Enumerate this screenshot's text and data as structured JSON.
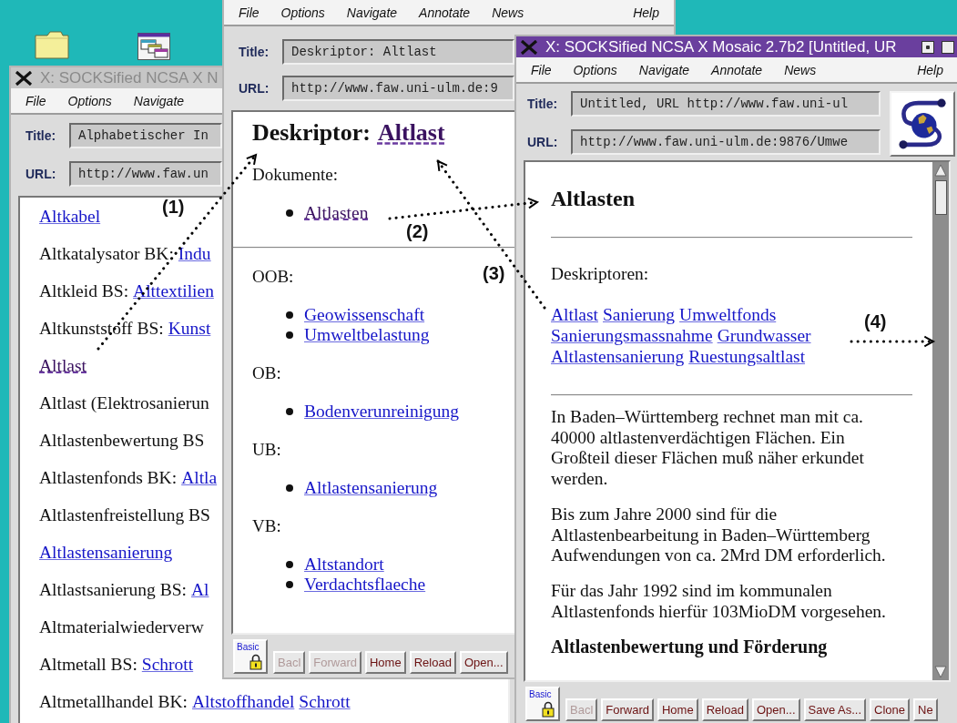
{
  "index_window": {
    "title_bar": {
      "title": "X: SOCKSified NCSA X N",
      "active": false
    },
    "menu": [
      {
        "label": "File"
      },
      {
        "label": "Options"
      },
      {
        "label": "Navigate"
      }
    ],
    "title_field": {
      "label": "Title:",
      "value": "Alphabetischer In"
    },
    "url_field": {
      "label": "URL:",
      "value": "http://www.faw.un"
    },
    "rows": [
      {
        "links": [
          {
            "text": "Altkabel",
            "visited": false
          }
        ]
      },
      {
        "term": "Altkatalysator BK:",
        "links": [
          {
            "text": "Indu",
            "visited": false
          }
        ]
      },
      {
        "term": "Altkleid BS:",
        "links": [
          {
            "text": "Alttextilien",
            "visited": false
          }
        ]
      },
      {
        "term": "Altkunststoff BS:",
        "links": [
          {
            "text": "Kunst",
            "visited": false
          }
        ]
      },
      {
        "links": [
          {
            "text": "Altlast",
            "visited": true
          }
        ]
      },
      {
        "term": "Altlast (Elektrosanierun"
      },
      {
        "term": "Altlastenbewertung BS"
      },
      {
        "term": "Altlastenfonds BK:",
        "links": [
          {
            "text": "Altla",
            "visited": false
          }
        ]
      },
      {
        "term": "Altlastenfreistellung BS"
      },
      {
        "links": [
          {
            "text": "Altlastensanierung",
            "visited": false
          }
        ]
      },
      {
        "term": "Altlastsanierung BS:",
        "links": [
          {
            "text": "Al",
            "visited": false
          }
        ]
      },
      {
        "term": "Altmaterialwiederverw"
      },
      {
        "term": "Altmetall BS:",
        "links": [
          {
            "text": "Schrott",
            "visited": false
          }
        ]
      },
      {
        "term": "Altmetallhandel BK:",
        "links": [
          {
            "text": "Altstoffhandel",
            "visited": false
          },
          {
            "text": "Schrott",
            "visited": false
          }
        ]
      }
    ]
  },
  "descriptor_window": {
    "menu": [
      {
        "label": "File",
        "kind": "menu"
      },
      {
        "label": "Options",
        "kind": "menu"
      },
      {
        "label": "Navigate",
        "kind": "menu"
      },
      {
        "label": "Annotate",
        "kind": "menu"
      },
      {
        "label": "News",
        "kind": "menu"
      },
      {
        "label": "Help",
        "kind": "help"
      }
    ],
    "title_field": {
      "label": "Title:",
      "value": "Deskriptor: Altlast"
    },
    "url_field": {
      "label": "URL:",
      "value": "http://www.faw.uni-ulm.de:9"
    },
    "heading": {
      "text": "Deskriptor:",
      "link": {
        "text": "Altlast",
        "visited": true
      }
    },
    "blocks": [
      {
        "kind": "label",
        "text": "Dokumente:"
      },
      {
        "kind": "list",
        "items": [
          {
            "text": "Altlasten",
            "visited": true
          }
        ]
      },
      {
        "kind": "rule"
      },
      {
        "kind": "label",
        "text": "OOB:"
      },
      {
        "kind": "list",
        "items": [
          {
            "text": "Geowissenschaft",
            "visited": false
          },
          {
            "text": "Umweltbelastung",
            "visited": false
          }
        ]
      },
      {
        "kind": "label",
        "text": "OB:"
      },
      {
        "kind": "list",
        "items": [
          {
            "text": "Bodenverunreinigung",
            "visited": false
          }
        ]
      },
      {
        "kind": "label",
        "text": "UB:"
      },
      {
        "kind": "list",
        "items": [
          {
            "text": "Altlastensanierung",
            "visited": false
          }
        ]
      },
      {
        "kind": "label",
        "text": "VB:"
      },
      {
        "kind": "list",
        "items": [
          {
            "text": "Altstandort",
            "visited": false
          },
          {
            "text": "Verdachtsflaeche",
            "visited": false
          }
        ]
      }
    ],
    "security": "Basic",
    "toolbar": [
      {
        "label": "Bacl",
        "disabled": true
      },
      {
        "label": "Forward",
        "disabled": true
      },
      {
        "label": "Home",
        "disabled": false
      },
      {
        "label": "Reload",
        "disabled": false
      },
      {
        "label": "Open...",
        "disabled": false
      }
    ]
  },
  "document_window": {
    "title_bar": {
      "title": "X: SOCKSified NCSA X Mosaic 2.7b2 [Untitled, UR",
      "active": true
    },
    "menu": [
      {
        "label": "File",
        "kind": "menu"
      },
      {
        "label": "Options",
        "kind": "menu"
      },
      {
        "label": "Navigate",
        "kind": "menu"
      },
      {
        "label": "Annotate",
        "kind": "menu"
      },
      {
        "label": "News",
        "kind": "menu"
      },
      {
        "label": "Help",
        "kind": "help"
      }
    ],
    "title_field": {
      "label": "Title:",
      "value": "Untitled, URL http://www.faw.uni-ul"
    },
    "url_field": {
      "label": "URL:",
      "value": "http://www.faw.uni-ulm.de:9876/Umwe"
    },
    "blocks": [
      {
        "kind": "heading",
        "text": "Altlasten"
      },
      {
        "kind": "rule"
      },
      {
        "kind": "label",
        "text": "Deskriptoren:"
      },
      {
        "kind": "links",
        "lines": [
          [
            {
              "text": "Altlast",
              "visited": false
            },
            {
              "text": "Sanierung",
              "visited": false
            },
            {
              "text": "Umweltfonds",
              "visited": false
            }
          ],
          [
            {
              "text": "Sanierungsmassnahme",
              "visited": false
            },
            {
              "text": "Grundwasser",
              "visited": false
            }
          ],
          [
            {
              "text": "Altlastensanierung",
              "visited": false
            },
            {
              "text": "Ruestungsaltlast",
              "visited": false
            }
          ]
        ]
      },
      {
        "kind": "rule"
      },
      {
        "kind": "paragraph",
        "text": "In Baden–Württemberg rechnet man mit ca. 40000 altlastenverdächtigen Flächen. Ein Großteil dieser Flächen muß näher erkundet werden."
      },
      {
        "kind": "paragraph",
        "text": "Bis zum Jahre 2000 sind für die Altlastenbearbeitung in Baden–Württemberg Aufwendungen von ca. 2Mrd DM erforderlich."
      },
      {
        "kind": "paragraph",
        "text": "Für das Jahr 1992 sind im kommunalen Altlastenfonds hierfür 103MioDM vorgesehen."
      },
      {
        "kind": "subheading",
        "text": "Altlastenbewertung und Förderung"
      }
    ],
    "security": "Basic",
    "toolbar": [
      {
        "label": "Bacl",
        "disabled": true
      },
      {
        "label": "Forward",
        "disabled": false
      },
      {
        "label": "Home",
        "disabled": false
      },
      {
        "label": "Reload",
        "disabled": false
      },
      {
        "label": "Open...",
        "disabled": false
      },
      {
        "label": "Save As...",
        "disabled": false
      },
      {
        "label": "Clone",
        "disabled": false
      },
      {
        "label": "Ne",
        "disabled": false
      }
    ]
  },
  "annotations": [
    {
      "label": "(1)"
    },
    {
      "label": "(2)"
    },
    {
      "label": "(3)"
    },
    {
      "label": "(4)"
    }
  ]
}
